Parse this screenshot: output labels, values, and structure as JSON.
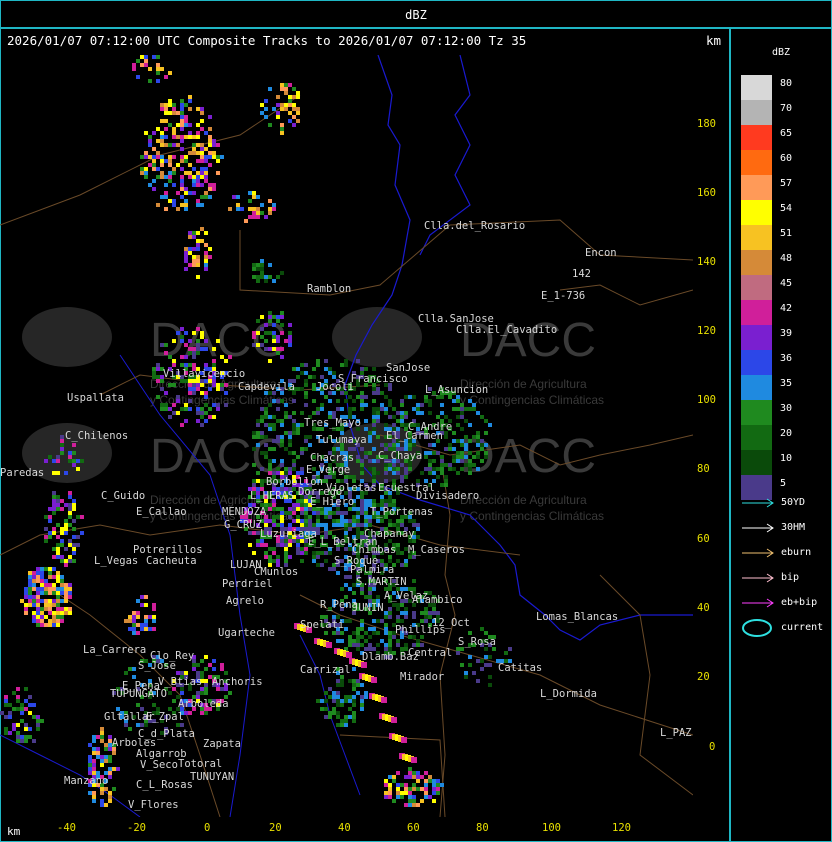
{
  "title": "dBZ",
  "header": {
    "caption": "2026/01/07 07:12:00 UTC Composite Tracks to 2026/01/07 07:12:00 Tz 35",
    "unit": "km"
  },
  "axes": {
    "y_ticks": [
      "180",
      "160",
      "140",
      "120",
      "100",
      "80",
      "60",
      "40",
      "20",
      "0"
    ],
    "x_ticks": [
      "-40",
      "-20",
      "0",
      "20",
      "40",
      "60",
      "80",
      "100",
      "120"
    ],
    "x_unit": "km"
  },
  "legend": {
    "title": "dBZ",
    "levels": [
      {
        "label": "80",
        "color": "#d8d8d8"
      },
      {
        "label": "70",
        "color": "#b4b4b4"
      },
      {
        "label": "65",
        "color": "#ff3a1f"
      },
      {
        "label": "60",
        "color": "#ff6a10"
      },
      {
        "label": "57",
        "color": "#ff9a58"
      },
      {
        "label": "54",
        "color": "#ffff00"
      },
      {
        "label": "51",
        "color": "#f7c222"
      },
      {
        "label": "48",
        "color": "#d58a38"
      },
      {
        "label": "45",
        "color": "#c06b80"
      },
      {
        "label": "42",
        "color": "#d01f9a"
      },
      {
        "label": "39",
        "color": "#7a1fd0"
      },
      {
        "label": "36",
        "color": "#2c47e8"
      },
      {
        "label": "35",
        "color": "#1f8ae0"
      },
      {
        "label": "30",
        "color": "#1f8a1f"
      },
      {
        "label": "20",
        "color": "#126a12"
      },
      {
        "label": "10",
        "color": "#0a4a0a"
      },
      {
        "label": "5",
        "color": "#4a3a8a"
      }
    ],
    "tracks": [
      {
        "label": "50YD",
        "color": "#2ee0e0"
      },
      {
        "label": "30HM",
        "color": "#ffffff"
      },
      {
        "label": "eburn",
        "color": "#f0c070"
      },
      {
        "label": "bip",
        "color": "#ffc0d0"
      },
      {
        "label": "eb+bip",
        "color": "#ff40ff"
      }
    ],
    "current": {
      "label": "current",
      "color": "#2ee0e0"
    }
  },
  "watermark": {
    "brand": "DACC",
    "line1": "Dirección de Agricultura",
    "line2": "y Contingencias Climáticas"
  },
  "places": [
    "Clla.del_Rosario",
    "Encon",
    "142",
    "E_1-736",
    "Ramblon",
    "Clla.SanJose",
    "Clla.El_Cavadito",
    "Villavicencio",
    "Capdevila",
    "S_Francisco",
    "SanJose",
    "L_Asuncion",
    "Uspallata",
    "Jocoli",
    "Tres_Mayo",
    "C_Andre",
    "C_Chilenos",
    "Tulumaya",
    "El_Carmen",
    "Paredas",
    "Chacras",
    "C_Chaya",
    "E_Verge",
    "Borbollon",
    "Dorrego",
    "Violetas",
    "Ecuestral",
    "Divisadero",
    "L_HERAS",
    "E_Hiero",
    "C_Guido",
    "MENDOZA",
    "T_Portenas",
    "E_Callao",
    "G_CRUZ",
    "Luzuriaga",
    "Chapanay",
    "E_L_Beltran",
    "Chimbas",
    "M_Caseros",
    "Potrerillos",
    "L_Vegas",
    "Cacheuta",
    "LUJAN",
    "S_Roque",
    "Palmira",
    "CMunlos",
    "S.MARTIN",
    "Perdriel",
    "Agrelo",
    "R_Pena",
    "JUNIN",
    "A_Velaz",
    "Alambico",
    "Ugarteche",
    "12_Oct",
    "Lomas_Blancas",
    "La_Carrera",
    "Clo_Rey",
    "S_Rosa",
    "S_Jose",
    "Catitas",
    "E_Pena",
    "V_Btias",
    "Anchoris",
    "Carrizal",
    "Mirador",
    "TUPUNGATO",
    "L_Dormida",
    "Arboleda",
    "Gltallar",
    "E_Zpal",
    "Arboles",
    "C_d_Plata",
    "Zapata",
    "Algarrob",
    "V_Seco",
    "Totoral",
    "TUNUYAN",
    "Manzano",
    "C_L_Rosas",
    "V_Flores",
    "L_PAZ",
    "Central",
    "Phillips",
    "Spelati",
    "Dlamb.Baz"
  ]
}
